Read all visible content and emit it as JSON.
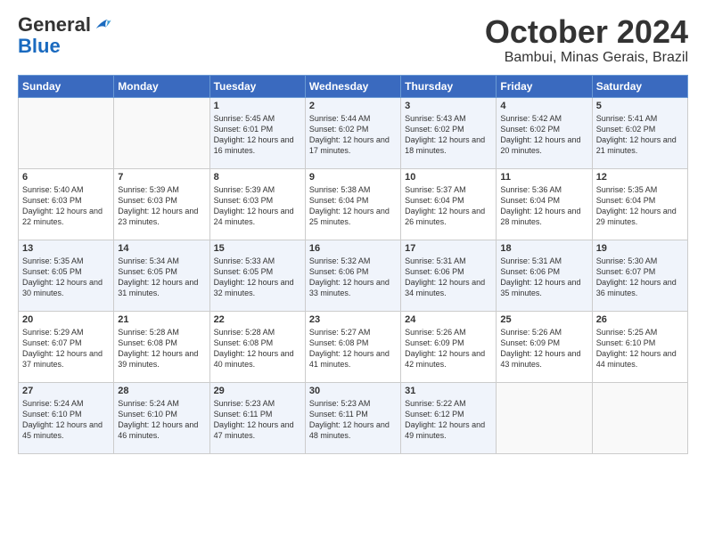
{
  "logo": {
    "general": "General",
    "blue": "Blue"
  },
  "title": "October 2024",
  "location": "Bambui, Minas Gerais, Brazil",
  "days_of_week": [
    "Sunday",
    "Monday",
    "Tuesday",
    "Wednesday",
    "Thursday",
    "Friday",
    "Saturday"
  ],
  "weeks": [
    [
      {
        "num": "",
        "info": ""
      },
      {
        "num": "",
        "info": ""
      },
      {
        "num": "1",
        "info": "Sunrise: 5:45 AM\nSunset: 6:01 PM\nDaylight: 12 hours and 16 minutes."
      },
      {
        "num": "2",
        "info": "Sunrise: 5:44 AM\nSunset: 6:02 PM\nDaylight: 12 hours and 17 minutes."
      },
      {
        "num": "3",
        "info": "Sunrise: 5:43 AM\nSunset: 6:02 PM\nDaylight: 12 hours and 18 minutes."
      },
      {
        "num": "4",
        "info": "Sunrise: 5:42 AM\nSunset: 6:02 PM\nDaylight: 12 hours and 20 minutes."
      },
      {
        "num": "5",
        "info": "Sunrise: 5:41 AM\nSunset: 6:02 PM\nDaylight: 12 hours and 21 minutes."
      }
    ],
    [
      {
        "num": "6",
        "info": "Sunrise: 5:40 AM\nSunset: 6:03 PM\nDaylight: 12 hours and 22 minutes."
      },
      {
        "num": "7",
        "info": "Sunrise: 5:39 AM\nSunset: 6:03 PM\nDaylight: 12 hours and 23 minutes."
      },
      {
        "num": "8",
        "info": "Sunrise: 5:39 AM\nSunset: 6:03 PM\nDaylight: 12 hours and 24 minutes."
      },
      {
        "num": "9",
        "info": "Sunrise: 5:38 AM\nSunset: 6:04 PM\nDaylight: 12 hours and 25 minutes."
      },
      {
        "num": "10",
        "info": "Sunrise: 5:37 AM\nSunset: 6:04 PM\nDaylight: 12 hours and 26 minutes."
      },
      {
        "num": "11",
        "info": "Sunrise: 5:36 AM\nSunset: 6:04 PM\nDaylight: 12 hours and 28 minutes."
      },
      {
        "num": "12",
        "info": "Sunrise: 5:35 AM\nSunset: 6:04 PM\nDaylight: 12 hours and 29 minutes."
      }
    ],
    [
      {
        "num": "13",
        "info": "Sunrise: 5:35 AM\nSunset: 6:05 PM\nDaylight: 12 hours and 30 minutes."
      },
      {
        "num": "14",
        "info": "Sunrise: 5:34 AM\nSunset: 6:05 PM\nDaylight: 12 hours and 31 minutes."
      },
      {
        "num": "15",
        "info": "Sunrise: 5:33 AM\nSunset: 6:05 PM\nDaylight: 12 hours and 32 minutes."
      },
      {
        "num": "16",
        "info": "Sunrise: 5:32 AM\nSunset: 6:06 PM\nDaylight: 12 hours and 33 minutes."
      },
      {
        "num": "17",
        "info": "Sunrise: 5:31 AM\nSunset: 6:06 PM\nDaylight: 12 hours and 34 minutes."
      },
      {
        "num": "18",
        "info": "Sunrise: 5:31 AM\nSunset: 6:06 PM\nDaylight: 12 hours and 35 minutes."
      },
      {
        "num": "19",
        "info": "Sunrise: 5:30 AM\nSunset: 6:07 PM\nDaylight: 12 hours and 36 minutes."
      }
    ],
    [
      {
        "num": "20",
        "info": "Sunrise: 5:29 AM\nSunset: 6:07 PM\nDaylight: 12 hours and 37 minutes."
      },
      {
        "num": "21",
        "info": "Sunrise: 5:28 AM\nSunset: 6:08 PM\nDaylight: 12 hours and 39 minutes."
      },
      {
        "num": "22",
        "info": "Sunrise: 5:28 AM\nSunset: 6:08 PM\nDaylight: 12 hours and 40 minutes."
      },
      {
        "num": "23",
        "info": "Sunrise: 5:27 AM\nSunset: 6:08 PM\nDaylight: 12 hours and 41 minutes."
      },
      {
        "num": "24",
        "info": "Sunrise: 5:26 AM\nSunset: 6:09 PM\nDaylight: 12 hours and 42 minutes."
      },
      {
        "num": "25",
        "info": "Sunrise: 5:26 AM\nSunset: 6:09 PM\nDaylight: 12 hours and 43 minutes."
      },
      {
        "num": "26",
        "info": "Sunrise: 5:25 AM\nSunset: 6:10 PM\nDaylight: 12 hours and 44 minutes."
      }
    ],
    [
      {
        "num": "27",
        "info": "Sunrise: 5:24 AM\nSunset: 6:10 PM\nDaylight: 12 hours and 45 minutes."
      },
      {
        "num": "28",
        "info": "Sunrise: 5:24 AM\nSunset: 6:10 PM\nDaylight: 12 hours and 46 minutes."
      },
      {
        "num": "29",
        "info": "Sunrise: 5:23 AM\nSunset: 6:11 PM\nDaylight: 12 hours and 47 minutes."
      },
      {
        "num": "30",
        "info": "Sunrise: 5:23 AM\nSunset: 6:11 PM\nDaylight: 12 hours and 48 minutes."
      },
      {
        "num": "31",
        "info": "Sunrise: 5:22 AM\nSunset: 6:12 PM\nDaylight: 12 hours and 49 minutes."
      },
      {
        "num": "",
        "info": ""
      },
      {
        "num": "",
        "info": ""
      }
    ]
  ]
}
